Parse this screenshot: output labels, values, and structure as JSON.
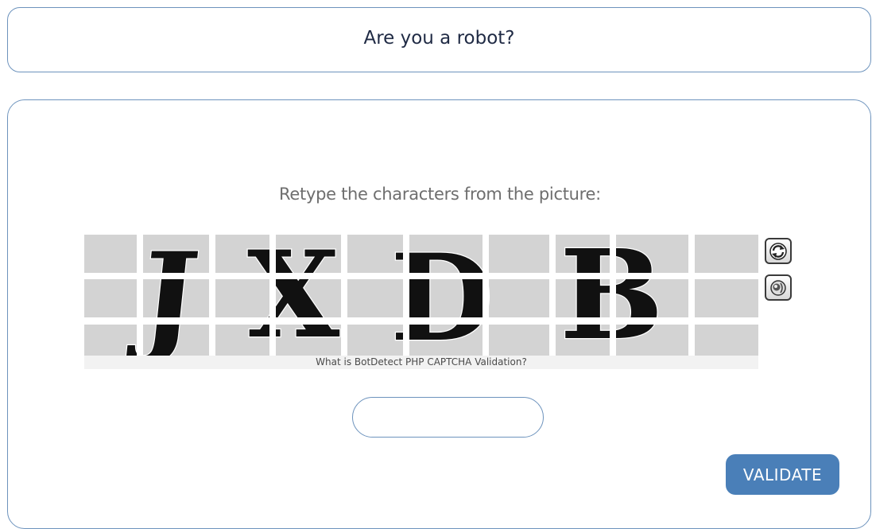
{
  "header": {
    "title": "Are you a robot?"
  },
  "captcha": {
    "instructions": "Retype the characters from the picture:",
    "characters": "JXDB",
    "help_link": "What is BotDetect PHP CAPTCHA Validation?",
    "reload_icon": "reload-icon",
    "sound_icon": "speaker-icon",
    "input_value": "",
    "input_placeholder": ""
  },
  "actions": {
    "validate_label": "VALIDATE"
  },
  "colors": {
    "border": "#6d93bd",
    "button": "#4a7fb8",
    "captcha_cell": "#d3d3d3",
    "title_text": "#1f2a44",
    "instruction_text": "#6e6e6e"
  }
}
